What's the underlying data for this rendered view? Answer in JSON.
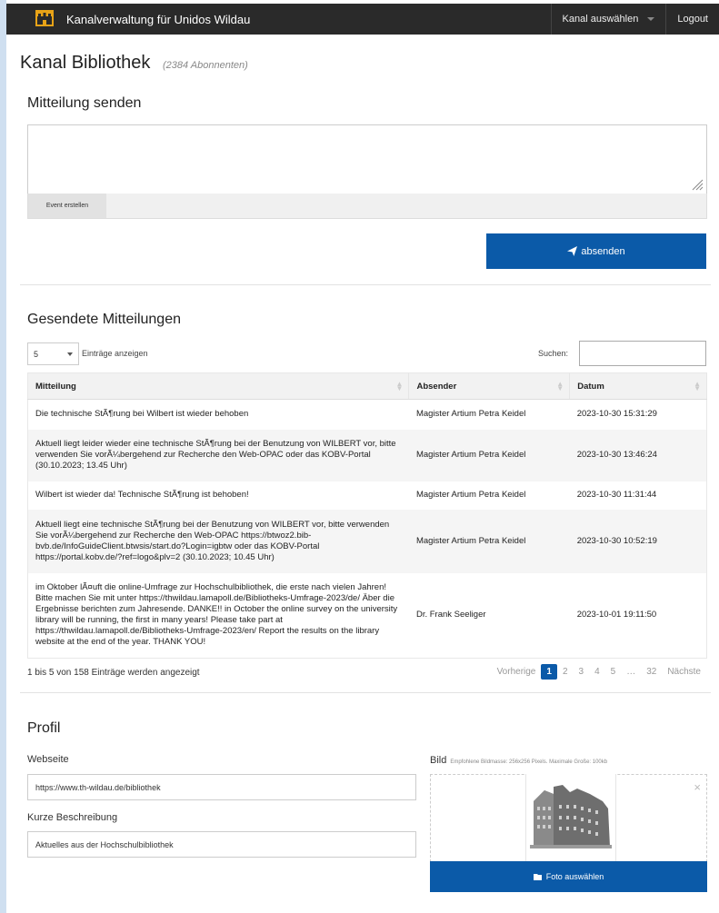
{
  "navbar": {
    "title": "Kanalverwaltung für Unidos Wildau",
    "channel_select": "Kanal auswählen",
    "logout": "Logout"
  },
  "header": {
    "title": "Kanal Bibliothek",
    "subscribers": "(2384 Abonnenten)"
  },
  "compose": {
    "heading": "Mitteilung senden",
    "message_value": "",
    "event_tab": "Event erstellen",
    "send_label": "absenden"
  },
  "sent": {
    "heading": "Gesendete Mitteilungen",
    "page_length": "5",
    "length_label": "Einträge anzeigen",
    "search_label": "Suchen:",
    "search_value": "",
    "columns": [
      "Mitteilung",
      "Absender",
      "Datum"
    ],
    "rows": [
      {
        "message": "Die technische StÃ¶rung bei Wilbert ist wieder behoben",
        "sender": "Magister Artium Petra Keidel",
        "date": "2023-10-30 15:31:29"
      },
      {
        "message": "Aktuell liegt leider wieder eine technische StÃ¶rung bei der Benutzung von WILBERT vor, bitte verwenden Sie vorÃ¼bergehend zur Recherche den Web-OPAC oder das KOBV-Portal (30.10.2023; 13.45 Uhr)",
        "sender": "Magister Artium Petra Keidel",
        "date": "2023-10-30 13:46:24"
      },
      {
        "message": "Wilbert ist wieder da! Technische StÃ¶rung ist behoben!",
        "sender": "Magister Artium Petra Keidel",
        "date": "2023-10-30 11:31:44"
      },
      {
        "message": "Aktuell liegt eine technische StÃ¶rung bei der Benutzung von WILBERT vor, bitte verwenden Sie vorÃ¼bergehend zur Recherche den Web-OPAC https://btwoz2.bib-bvb.de/InfoGuideClient.btwsis/start.do?Login=igbtw oder das KOBV-Portal https://portal.kobv.de/?ref=logo&plv=2 (30.10.2023; 10.45 Uhr)",
        "sender": "Magister Artium Petra Keidel",
        "date": "2023-10-30 10:52:19"
      },
      {
        "message": "im Oktober lÃ¤uft die online-Umfrage zur Hochschulbibliothek, die erste nach vielen Jahren! Bitte machen Sie mit unter https://thwildau.lamapoll.de/Bibliotheks-Umfrage-2023/de/ Äber die Ergebnisse berichten zum Jahresende. DANKE!! in October the online survey on the university library will be running, the first in many years! Please take part at https://thwildau.lamapoll.de/Bibliotheks-Umfrage-2023/en/ Report the results on the library website at the end of the year. THANK YOU!",
        "sender": "Dr. Frank Seeliger",
        "date": "2023-10-01 19:11:50"
      }
    ],
    "info": "1 bis 5 von 158 Einträge werden angezeigt",
    "pager": {
      "prev": "Vorherige",
      "pages": [
        "1",
        "2",
        "3",
        "4",
        "5",
        "…",
        "32"
      ],
      "next": "Nächste"
    }
  },
  "profile": {
    "heading": "Profil",
    "website_label": "Webseite",
    "website_value": "https://www.th-wildau.de/bibliothek",
    "desc_label": "Kurze Beschreibung",
    "desc_value": "Aktuelles aus der Hochschulbibliothek",
    "image_label": "Bild",
    "image_hint": "Empfohlene Bildmasse: 256x256 Pixels. Maximale Große: 100kb",
    "photo_button": "Foto auswählen"
  },
  "colors": {
    "navbar": "#2a2a2a",
    "primary": "#0b5aa8",
    "logo": "#e8a317"
  }
}
